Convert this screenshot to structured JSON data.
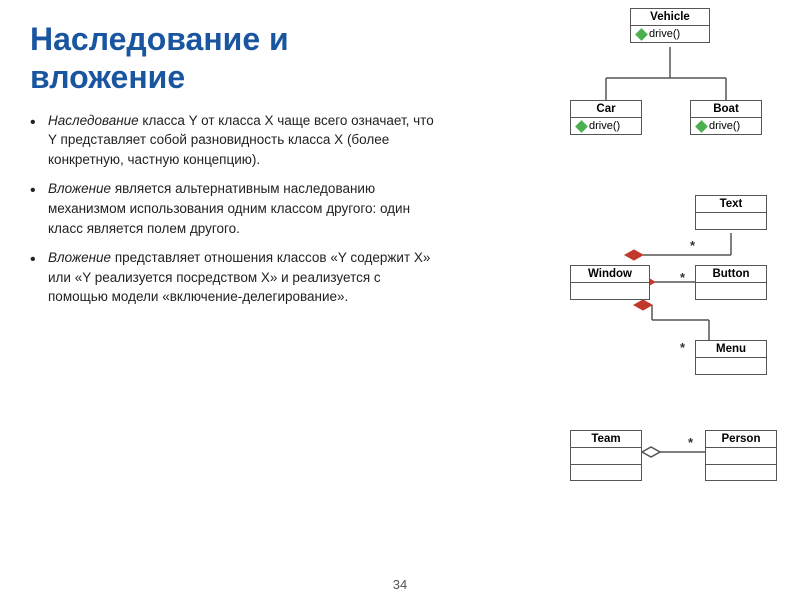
{
  "title": "Наследование и вложение",
  "bullets": [
    {
      "text_before": "",
      "italic": "Наследование",
      "text_after": " класса Y от класса X чаще всего означает, что Y представляет собой разновидность класса X (более конкретную, частную концепцию)."
    },
    {
      "text_before": "",
      "italic": "Вложение",
      "text_after": " является альтернативным наследованию механизмом использования одним классом другого: один класс является полем другого."
    },
    {
      "text_before": "",
      "italic": "Вложение",
      "text_after": " представляет отношения классов «Y содержит X» или «Y реализуется посредством X» и реализуется с помощью модели «включение-делегирование»."
    }
  ],
  "diagram": {
    "vehicle": {
      "name": "Vehicle",
      "method": "drive()"
    },
    "car": {
      "name": "Car",
      "method": "drive()"
    },
    "boat": {
      "name": "Boat",
      "method": "drive()"
    },
    "text_box": {
      "name": "Text"
    },
    "window": {
      "name": "Window"
    },
    "button": {
      "name": "Button"
    },
    "menu": {
      "name": "Menu"
    },
    "team": {
      "name": "Team"
    },
    "person": {
      "name": "Person"
    },
    "star1": "*",
    "star2": "*",
    "star3": "*",
    "star4": "*"
  },
  "page_number": "34"
}
